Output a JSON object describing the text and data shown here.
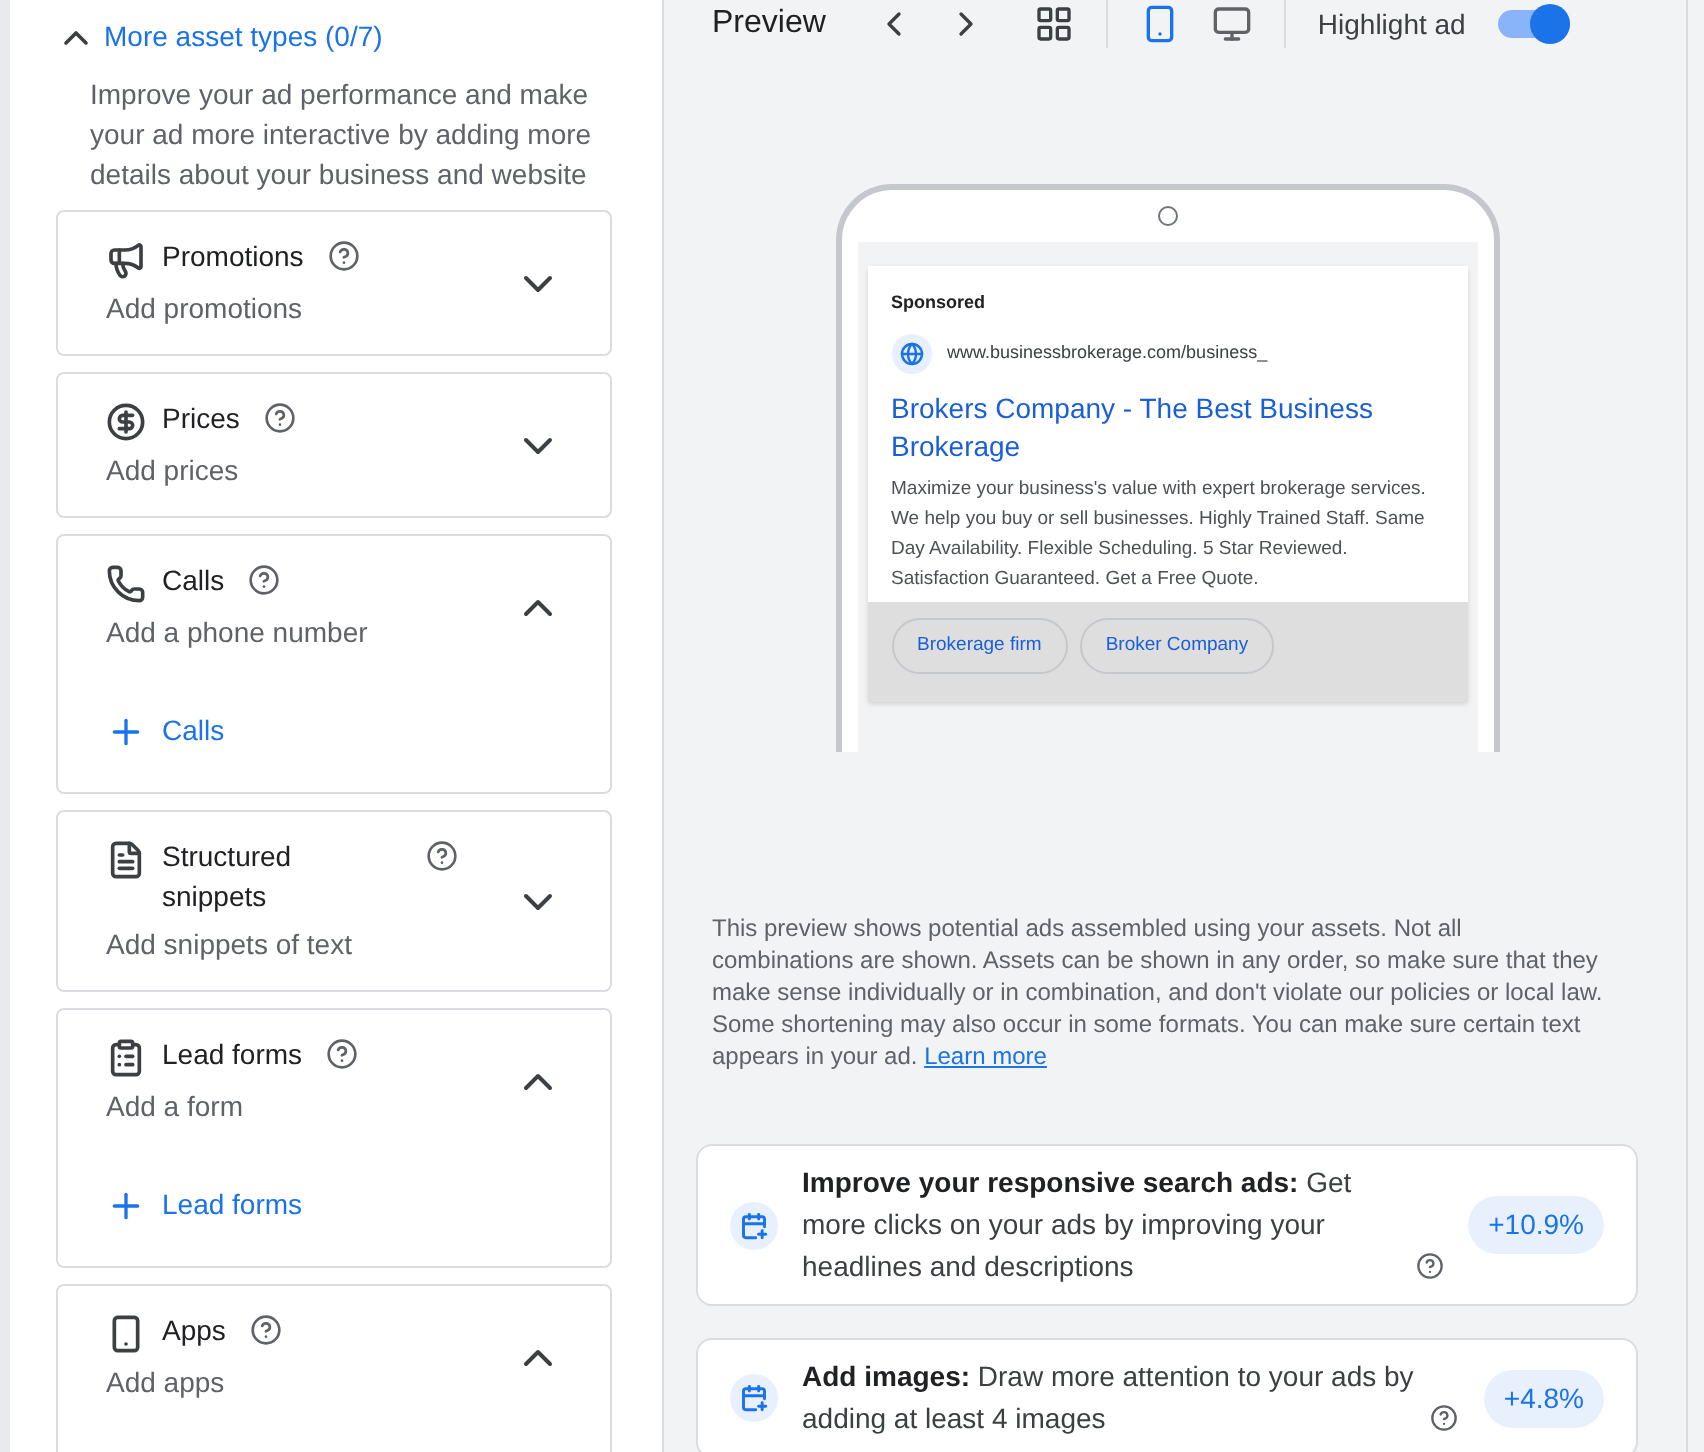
{
  "asset_types": {
    "title": "More asset types (0/7)",
    "expanded": true,
    "description": "Improve your ad performance and make your ad more interactive by adding more details about your business and website",
    "items": [
      {
        "kind": "promotions",
        "title": "Promotions",
        "subtitle": "Add promotions",
        "expanded": false
      },
      {
        "kind": "prices",
        "title": "Prices",
        "subtitle": "Add prices",
        "expanded": false
      },
      {
        "kind": "calls",
        "title": "Calls",
        "subtitle": "Add a phone number",
        "expanded": true,
        "add_label": "Calls"
      },
      {
        "kind": "snippets",
        "title": "Structured snippets",
        "subtitle": "Add snippets of text",
        "expanded": false
      },
      {
        "kind": "lead_forms",
        "title": "Lead forms",
        "subtitle": "Add a form",
        "expanded": true,
        "add_label": "Lead forms"
      },
      {
        "kind": "apps",
        "title": "Apps",
        "subtitle": "Add apps",
        "expanded": true
      }
    ]
  },
  "preview": {
    "title": "Preview",
    "devices": [
      {
        "kind": "mobile",
        "selected": true
      },
      {
        "kind": "desktop",
        "selected": false
      }
    ],
    "highlight": {
      "label": "Highlight ad",
      "on": true
    },
    "ad": {
      "sponsored": "Sponsored",
      "url": "www.businessbrokerage.com/business_",
      "headline": "Brokers Company - The Best Business Brokerage",
      "description": "Maximize your business's value with expert brokerage services. We help you buy or sell businesses. Highly Trained Staff. Same Day Availability. Flexible Scheduling. 5 Star Reviewed. Satisfaction Guaranteed. Get a Free Quote.",
      "sitelinks": [
        "Brokerage firm",
        "Broker Company"
      ]
    },
    "disclaimer": {
      "text": "This preview shows potential ads assembled using your assets. Not all combinations are shown. Assets can be shown in any order, so make sure that they make sense individually or in combination, and don't violate our policies or local law. Some shortening may also occur in some formats. You can make sure certain text appears in your ad.",
      "link": "Learn more"
    }
  },
  "recommendations": [
    {
      "title": "Improve your responsive search ads:",
      "body": "Get more clicks on your ads by improving your headlines and descriptions",
      "uplift": "+10.9%"
    },
    {
      "title": "Add images:",
      "body": "Draw more attention to your ads by adding at least 4 images",
      "uplift": "+4.8%"
    }
  ]
}
